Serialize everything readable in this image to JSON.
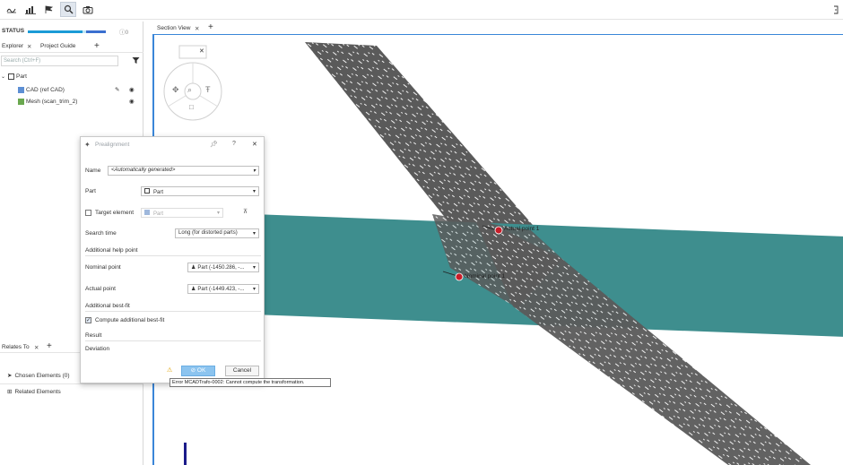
{
  "toolbar": {
    "buttons": [
      "curve-icon",
      "histogram-icon",
      "flag-icon",
      "magnifier-icon",
      "camera-icon"
    ],
    "right_icon": "bracket-icon"
  },
  "status": {
    "label": "STATUS",
    "info_count": "0",
    "progress": 0.7
  },
  "explorer": {
    "tabs": [
      "Explorer",
      "Project Guide"
    ],
    "add_label": "+",
    "search_placeholder": "Search (Ctrl+F)",
    "tree": {
      "root": "Part",
      "items": [
        "CAD (ref CAD)",
        "Mesh (scan_trim_2)"
      ]
    }
  },
  "relates": {
    "tab": "Relates To",
    "add_label": "+",
    "chosen": "Chosen Elements (0)",
    "related": "Related Elements"
  },
  "view": {
    "tab": "Section View",
    "add_label": "+",
    "overlay_close": "✕",
    "labels": {
      "actual": "Actual point 1",
      "nominal": "Nominal point 1"
    }
  },
  "dialog": {
    "title": "Prealignment",
    "help": "?",
    "close": "✕",
    "name_label": "Name",
    "name_value": "<Automatically generated>",
    "part_label": "Part",
    "part_value": "Part",
    "target_label": "Target element",
    "target_value": "Part",
    "search_time_label": "Search time",
    "search_time_value": "Long (for distorted parts)",
    "help_point_heading": "Additional help point",
    "nominal_label": "Nominal point",
    "nominal_value": "Part (-1450.286, -...",
    "actual_label": "Actual point",
    "actual_value": "Part (-1449.423, -...",
    "best_fit_heading": "Additional best-fit",
    "compute_label": "Compute additional best-fit",
    "compute_checked": true,
    "result_heading": "Result",
    "deviation_label": "Deviation",
    "ok_label": "OK",
    "cancel_label": "Cancel"
  },
  "tooltip": "Error MCADTrafo-0002: Cannot compute the transformation.",
  "colors": {
    "accent": "#3a86d8",
    "cad_band": "#3e8e8e",
    "mesh": "#5a5a5a",
    "point_marker": "#c81e2a"
  }
}
